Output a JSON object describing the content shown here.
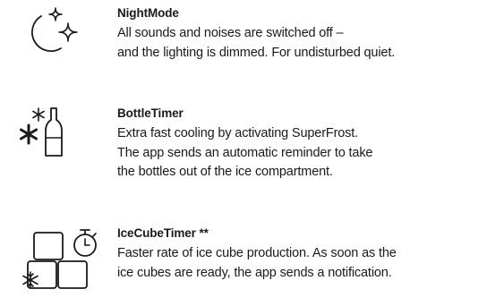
{
  "features": [
    {
      "icon": "night-mode-icon",
      "title": "NightMode",
      "lines": [
        "All sounds and noises are switched off –",
        "and the lighting is dimmed. For undisturbed quiet."
      ]
    },
    {
      "icon": "bottle-timer-icon",
      "title": "BottleTimer",
      "lines": [
        "Extra fast cooling by activating SuperFrost.",
        "The app sends an automatic reminder to take",
        "the bottles out of the ice compartment."
      ]
    },
    {
      "icon": "ice-cube-timer-icon",
      "title": "IceCubeTimer **",
      "lines": [
        "Faster rate of ice cube production. As soon as the",
        "ice cubes are ready, the app sends a notification."
      ]
    }
  ]
}
